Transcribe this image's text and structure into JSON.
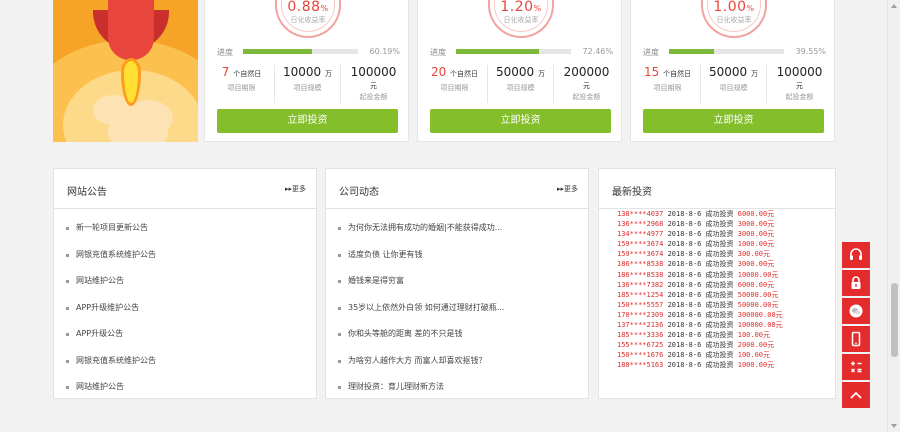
{
  "products": [
    {
      "rate": "0.88",
      "rate_unit": "%",
      "rate_label": "日化收益率",
      "progress_label": "进度",
      "progress_value": "60.19%",
      "progress_fraction": 0.6019,
      "term_value": "7",
      "term_unit": "个自然日",
      "term_key": "项目期限",
      "scale_value": "10000",
      "scale_unit": "万",
      "scale_key": "项目规模",
      "min_value": "100000",
      "min_unit": "元",
      "min_key": "起投金额",
      "button": "立即投资"
    },
    {
      "rate": "1.20",
      "rate_unit": "%",
      "rate_label": "日化收益率",
      "progress_label": "进度",
      "progress_value": "72.46%",
      "progress_fraction": 0.7246,
      "term_value": "20",
      "term_unit": "个自然日",
      "term_key": "项目期限",
      "scale_value": "50000",
      "scale_unit": "万",
      "scale_key": "项目规模",
      "min_value": "200000",
      "min_unit": "元",
      "min_key": "起投金额",
      "button": "立即投资"
    },
    {
      "rate": "1.00",
      "rate_unit": "%",
      "rate_label": "日化收益率",
      "progress_label": "进度",
      "progress_value": "39.55%",
      "progress_fraction": 0.3955,
      "term_value": "15",
      "term_unit": "个自然日",
      "term_key": "项目期限",
      "scale_value": "50000",
      "scale_unit": "万",
      "scale_key": "项目规模",
      "min_value": "100000",
      "min_unit": "元",
      "min_key": "起投金额",
      "button": "立即投资"
    }
  ],
  "notice": {
    "title": "网站公告",
    "more": "▸▸更多",
    "items": [
      "新一轮项目更新公告",
      "网银充值系统维护公告",
      "网站维护公告",
      "APP升级维护公告",
      "APP升级公告",
      "网银充值系统维护公告",
      "网站维护公告"
    ]
  },
  "news": {
    "title": "公司动态",
    "more": "▸▸更多",
    "items": [
      "为何你无法拥有成功的婚姻|不能获得成功...",
      "适度负债 让你更有钱",
      "婚钱来是得穷富",
      "35岁以上依然外白领 如何通过理财打破瓶...",
      "你和头等舱的距离 差的不只是钱",
      "为啥穷人越作大方 而富人却喜欢抠钱？",
      "理财投资：育儿理财新方法"
    ]
  },
  "invest": {
    "title": "最新投资",
    "records": [
      {
        "phone": "138****4037",
        "date": "2018-8-6",
        "text": "成功投资",
        "amount": "6000.00元"
      },
      {
        "phone": "136****2968",
        "date": "2018-8-6",
        "text": "成功投资",
        "amount": "3000.00元"
      },
      {
        "phone": "134****4977",
        "date": "2018-8-6",
        "text": "成功投资",
        "amount": "3000.00元"
      },
      {
        "phone": "159****3674",
        "date": "2018-8-6",
        "text": "成功投资",
        "amount": "1000.00元"
      },
      {
        "phone": "159****3674",
        "date": "2018-8-6",
        "text": "成功投资",
        "amount": "300.00元"
      },
      {
        "phone": "186****8538",
        "date": "2018-8-6",
        "text": "成功投资",
        "amount": "3000.00元"
      },
      {
        "phone": "186****8538",
        "date": "2018-8-6",
        "text": "成功投资",
        "amount": "10000.00元"
      },
      {
        "phone": "136****7382",
        "date": "2018-8-6",
        "text": "成功投资",
        "amount": "6000.00元"
      },
      {
        "phone": "185****1254",
        "date": "2018-8-6",
        "text": "成功投资",
        "amount": "50000.00元"
      },
      {
        "phone": "150****5557",
        "date": "2018-8-6",
        "text": "成功投资",
        "amount": "50000.00元"
      },
      {
        "phone": "170****2309",
        "date": "2018-8-6",
        "text": "成功投资",
        "amount": "300000.00元"
      },
      {
        "phone": "137****2136",
        "date": "2018-8-6",
        "text": "成功投资",
        "amount": "100000.00元"
      },
      {
        "phone": "185****3336",
        "date": "2018-8-6",
        "text": "成功投资",
        "amount": "100.00元"
      },
      {
        "phone": "155****6725",
        "date": "2018-8-6",
        "text": "成功投资",
        "amount": "2000.00元"
      },
      {
        "phone": "150****1676",
        "date": "2018-8-6",
        "text": "成功投资",
        "amount": "100.00元"
      },
      {
        "phone": "180****5163",
        "date": "2018-8-6",
        "text": "成功投资",
        "amount": "1000.00元"
      }
    ]
  },
  "sidebar": [
    "headset-icon",
    "lock-icon",
    "wechat-icon",
    "mobile-icon",
    "calculator-icon",
    "back-to-top-icon"
  ],
  "colors": {
    "accent_red": "#e52c2c",
    "button_green": "#84be2a",
    "progress_green": "#7cb83a"
  }
}
